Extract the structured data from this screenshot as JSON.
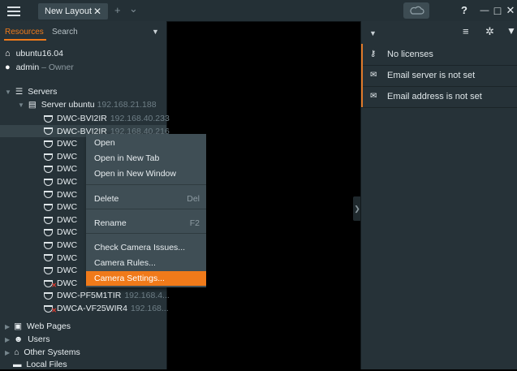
{
  "titlebar": {
    "tab_label": "New Layout",
    "tab_close": "✕",
    "add_tab": "+",
    "tab_dropdown": "⌄",
    "help": "?",
    "minimize": "—",
    "maximize": "□",
    "close": "✕"
  },
  "left_panel": {
    "tabs": [
      "Resources",
      "Search"
    ],
    "system": {
      "name": "ubuntu16.04"
    },
    "user": {
      "name": "admin",
      "role": "– Owner"
    },
    "servers_label": "Servers",
    "server": {
      "name": "Server ubuntu",
      "ip": "192.168.21.188"
    },
    "cameras": [
      {
        "name": "DWC-BVI2IR",
        "ip": "192.168.40.233",
        "error": false
      },
      {
        "name": "DWC-BVI2IR",
        "ip": "192.168.40.216",
        "error": false
      },
      {
        "name": "DWC",
        "ip": "",
        "error": false
      },
      {
        "name": "DWC",
        "ip": "",
        "error": false
      },
      {
        "name": "DWC",
        "ip": "",
        "error": false
      },
      {
        "name": "DWC",
        "ip": "",
        "error": false
      },
      {
        "name": "DWC",
        "ip": "",
        "error": false
      },
      {
        "name": "DWC",
        "ip": "",
        "error": false
      },
      {
        "name": "DWC",
        "ip": "",
        "error": false
      },
      {
        "name": "DWC",
        "ip": "",
        "error": false
      },
      {
        "name": "DWC",
        "ip": "",
        "error": false
      },
      {
        "name": "DWC",
        "ip": "",
        "error": false
      },
      {
        "name": "DWC",
        "ip": "",
        "error": false
      },
      {
        "name": "DWC",
        "ip": "",
        "error": true
      },
      {
        "name": "DWC-PF5M1TIR",
        "ip": "192.168.4...",
        "error": false
      },
      {
        "name": "DWCA-VF25WIR4",
        "ip": "192.168...",
        "error": true
      }
    ],
    "groups": [
      "Web Pages",
      "Users",
      "Other Systems",
      "Local Files"
    ]
  },
  "context_menu": {
    "items": [
      {
        "label": "Open",
        "shortcut": ""
      },
      {
        "label": "Open in New Tab",
        "shortcut": ""
      },
      {
        "label": "Open in New Window",
        "shortcut": ""
      },
      {
        "label": "Delete",
        "shortcut": "Del"
      },
      {
        "label": "Rename",
        "shortcut": "F2"
      },
      {
        "label": "Check Camera Issues...",
        "shortcut": ""
      },
      {
        "label": "Camera Rules...",
        "shortcut": ""
      },
      {
        "label": "Camera Settings...",
        "shortcut": ""
      }
    ],
    "selected": "Camera Settings..."
  },
  "notifications": [
    {
      "text": "No licenses",
      "icon": "key-icon"
    },
    {
      "text": "Email server is not set",
      "icon": "mail-icon"
    },
    {
      "text": "Email address is not set",
      "icon": "mail-icon"
    }
  ],
  "colors": {
    "accent": "#f07a1a",
    "panel": "#263238",
    "menu": "#3f4e55"
  }
}
